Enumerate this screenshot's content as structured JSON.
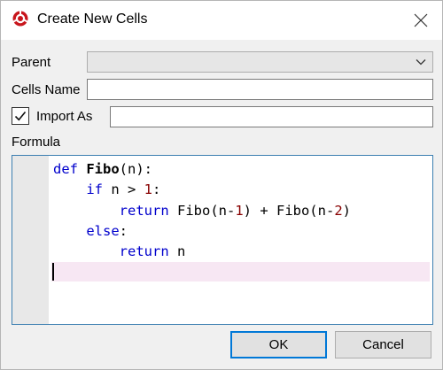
{
  "window": {
    "title": "Create New Cells",
    "accent_color": "#0078d7"
  },
  "form": {
    "parent_label": "Parent",
    "parent_value": "",
    "cells_name_label": "Cells Name",
    "cells_name_value": "",
    "import_as_label": "Import As",
    "import_as_checked": true,
    "import_as_value": "",
    "formula_label": "Formula"
  },
  "formula": {
    "lines": [
      [
        {
          "t": "def",
          "c": "kw"
        },
        {
          "t": " "
        },
        {
          "t": "Fibo",
          "c": "fn"
        },
        {
          "t": "(n):"
        }
      ],
      [
        {
          "t": "    "
        },
        {
          "t": "if",
          "c": "kw"
        },
        {
          "t": " n > "
        },
        {
          "t": "1",
          "c": "num"
        },
        {
          "t": ":"
        }
      ],
      [
        {
          "t": "        "
        },
        {
          "t": "return",
          "c": "kw"
        },
        {
          "t": " Fibo(n-"
        },
        {
          "t": "1",
          "c": "num"
        },
        {
          "t": ") + Fibo(n-"
        },
        {
          "t": "2",
          "c": "num"
        },
        {
          "t": ")"
        }
      ],
      [
        {
          "t": "    "
        },
        {
          "t": "else",
          "c": "kw"
        },
        {
          "t": ":"
        }
      ],
      [
        {
          "t": "        "
        },
        {
          "t": "return",
          "c": "kw"
        },
        {
          "t": " n"
        }
      ],
      []
    ]
  },
  "buttons": {
    "ok_label": "OK",
    "cancel_label": "Cancel"
  }
}
